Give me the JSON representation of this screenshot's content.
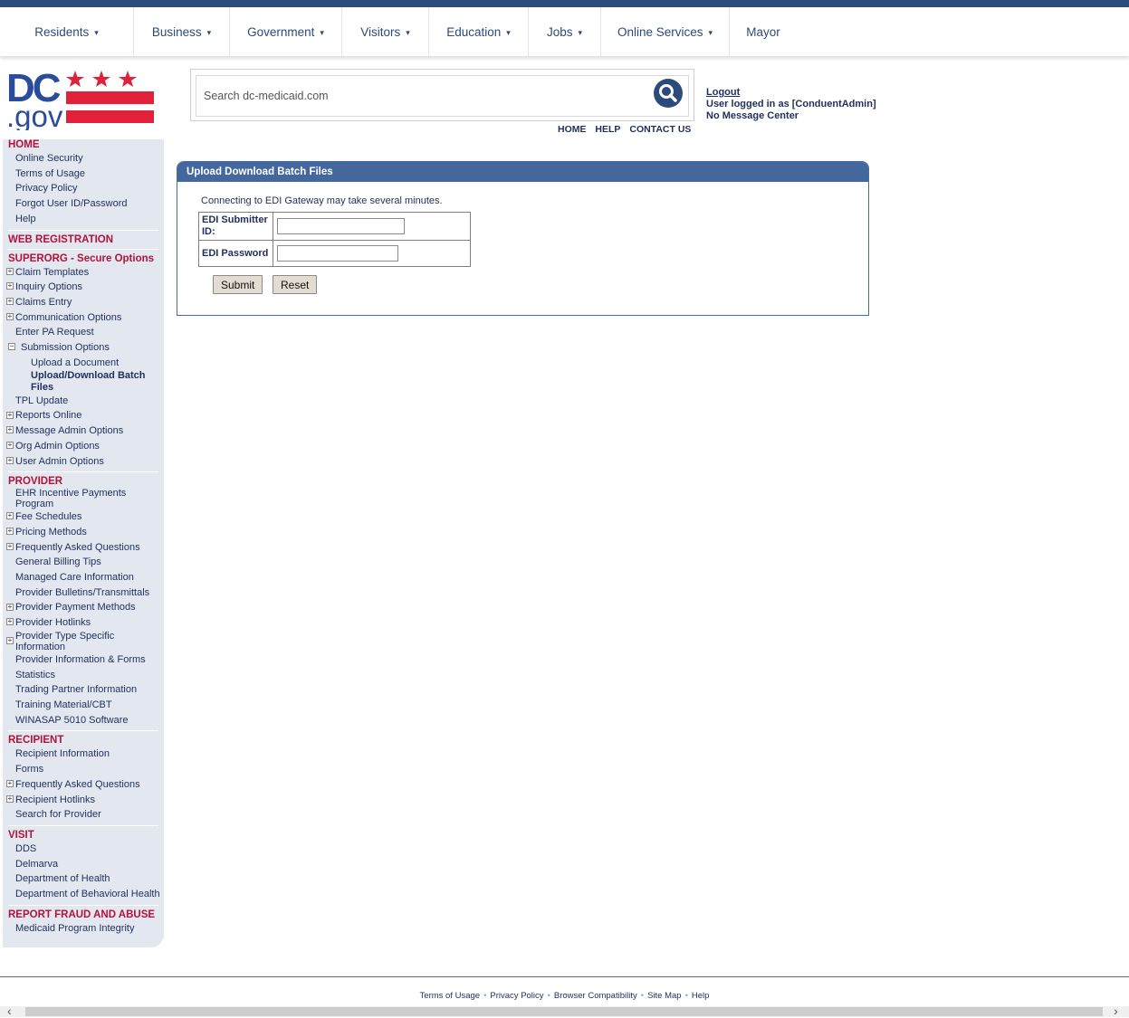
{
  "nav": {
    "items": [
      {
        "label": "Residents",
        "caret": "▾"
      },
      {
        "label": "Business",
        "caret": "▾"
      },
      {
        "label": "Government",
        "caret": "▾"
      },
      {
        "label": "Visitors",
        "caret": "▾"
      },
      {
        "label": "Education",
        "caret": "▾"
      },
      {
        "label": "Jobs",
        "caret": "▾"
      },
      {
        "label": "Online Services",
        "caret": "▾"
      },
      {
        "label": "Mayor"
      }
    ]
  },
  "logo": {
    "top": "DC",
    "bottom": ".gov"
  },
  "search": {
    "placeholder": "Search dc-medicaid.com",
    "icon": "search-icon"
  },
  "util_links": {
    "home": "HOME",
    "help": "HELP",
    "contact": "CONTACT US"
  },
  "user": {
    "logout": "Logout",
    "logged_in": "User logged in as [ConduentAdmin]",
    "message_center": "No Message Center"
  },
  "sidebar": {
    "home": "HOME",
    "home_items": [
      "Online Security",
      "Terms of Usage",
      "Privacy Policy",
      "Forgot User ID/Password",
      "Help"
    ],
    "web_registration": "WEB REGISTRATION",
    "superorg": "SUPERORG - Secure Options",
    "superorg_items": [
      {
        "label": "Claim Templates",
        "pm": "+"
      },
      {
        "label": "Inquiry Options",
        "pm": "+"
      },
      {
        "label": "Claims Entry",
        "pm": "+"
      },
      {
        "label": "Communication Options",
        "pm": "+"
      },
      {
        "label": "Enter PA Request"
      },
      {
        "label": "Submission Options",
        "pm": "−"
      }
    ],
    "submission_subs": [
      "Upload a Document",
      "Upload/Download Batch Files"
    ],
    "superorg_items2": [
      {
        "label": "TPL Update"
      },
      {
        "label": "Reports Online",
        "pm": "+"
      },
      {
        "label": "Message Admin Options",
        "pm": "+"
      },
      {
        "label": "Org Admin Options",
        "pm": "+"
      },
      {
        "label": "User Admin Options",
        "pm": "+"
      }
    ],
    "provider": "PROVIDER",
    "provider_items": [
      {
        "label": "EHR Incentive Payments Program"
      },
      {
        "label": "Fee Schedules",
        "pm": "+"
      },
      {
        "label": "Pricing Methods",
        "pm": "+"
      },
      {
        "label": "Frequently Asked Questions",
        "pm": "+"
      },
      {
        "label": "General Billing Tips"
      },
      {
        "label": "Managed Care Information"
      },
      {
        "label": "Provider Bulletins/Transmittals"
      },
      {
        "label": "Provider Payment Methods",
        "pm": "+"
      },
      {
        "label": "Provider Hotlinks",
        "pm": "+"
      },
      {
        "label": "Provider Type Specific Information",
        "pm": "+"
      },
      {
        "label": "Provider Information & Forms"
      },
      {
        "label": "Statistics"
      },
      {
        "label": "Trading Partner Information"
      },
      {
        "label": "Training Material/CBT"
      },
      {
        "label": "WINASAP 5010 Software"
      }
    ],
    "recipient": "RECIPIENT",
    "recipient_items": [
      {
        "label": "Recipient Information"
      },
      {
        "label": "Forms"
      },
      {
        "label": "Frequently Asked Questions",
        "pm": "+"
      },
      {
        "label": "Recipient Hotlinks",
        "pm": "+"
      },
      {
        "label": "Search for Provider"
      }
    ],
    "visit": "VISIT",
    "visit_items": [
      "DDS",
      "Delmarva",
      "Department of Health",
      "Department of Behavioral Health"
    ],
    "fraud": "REPORT FRAUD AND ABUSE",
    "fraud_items": [
      "Medicaid Program Integrity"
    ]
  },
  "panel": {
    "title": "Upload Download Batch Files",
    "note": "Connecting to EDI Gateway may take several minutes.",
    "submitter_label": "EDI Submitter ID:",
    "password_label": "EDI Password",
    "submitter_value": "",
    "password_value": "",
    "submit": "Submit",
    "reset": "Reset"
  },
  "footer": {
    "links": [
      "Terms of Usage",
      "Privacy Policy",
      "Browser Compatibility",
      "Site Map",
      "Help"
    ],
    "separator": "•"
  },
  "colors": {
    "navy": "#2d4a7d",
    "accent_red": "#b3123a",
    "panel_header": "#44689e"
  }
}
